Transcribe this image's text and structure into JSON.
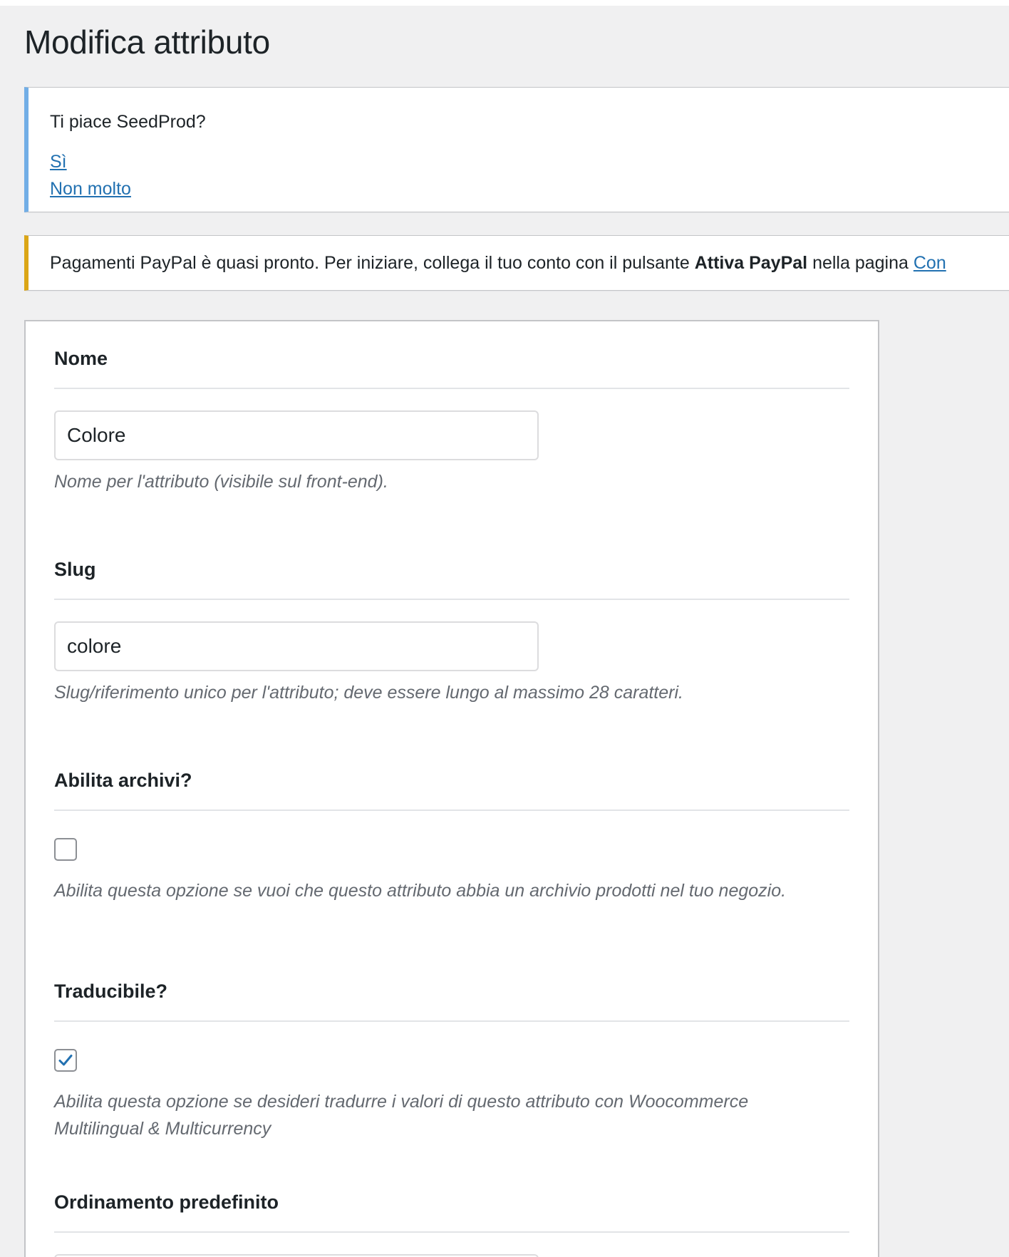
{
  "page": {
    "title": "Modifica attributo"
  },
  "notice_seedprod": {
    "question": "Ti piace SeedProd?",
    "yes_link": "Sì",
    "no_link": "Non molto"
  },
  "notice_paypal": {
    "text_before": "Pagamenti PayPal è quasi pronto. Per iniziare, collega il tuo conto con il pulsante ",
    "bold_text": "Attiva PayPal",
    "text_after": " nella pagina ",
    "link_text": "Con"
  },
  "form": {
    "name": {
      "label": "Nome",
      "value": "Colore",
      "description": "Nome per l'attributo (visibile sul front-end)."
    },
    "slug": {
      "label": "Slug",
      "value": "colore",
      "description": "Slug/riferimento unico per l'attributo; deve essere lungo al massimo 28 caratteri."
    },
    "archives": {
      "label": "Abilita archivi?",
      "checked": false,
      "description": "Abilita questa opzione se vuoi che questo attributo abbia un archivio prodotti nel tuo negozio."
    },
    "translatable": {
      "label": "Traducibile?",
      "checked": true,
      "description": "Abilita questa opzione se desideri tradurre i valori di questo attributo con Woocommerce Multilingual & Multicurrency"
    },
    "default_sort": {
      "label": "Ordinamento predefinito"
    }
  },
  "colors": {
    "admin_background": "#f0f0f1",
    "link": "#2271b1",
    "info_border": "#72aee6",
    "warning_border": "#dba617",
    "checkmark": "#2271b1"
  }
}
